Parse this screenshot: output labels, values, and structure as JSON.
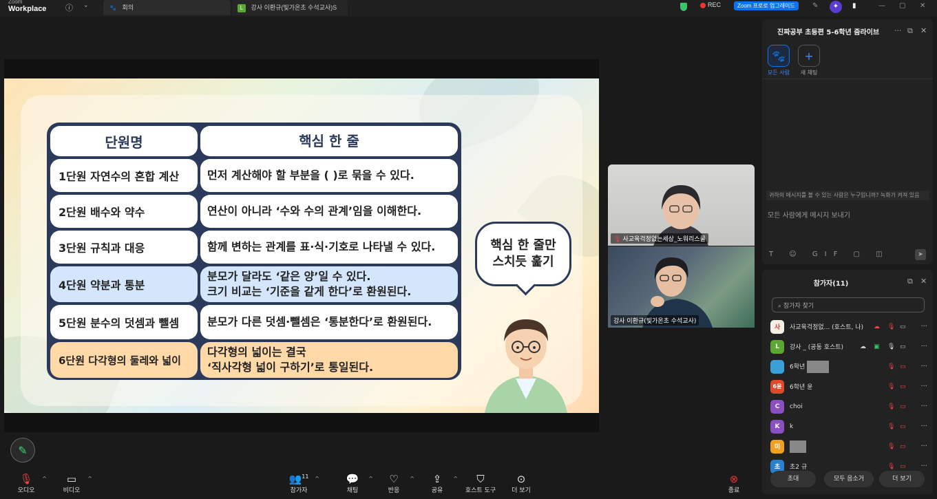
{
  "topbar": {
    "brand_line1": "Zoom",
    "brand_line2": "Workplace",
    "meeting_tab": "회의",
    "talk_tab": "강사 이환규(빛가온초 수석교사)S",
    "rec_label": "REC",
    "upgrade_label": "Zoom 프로로 업그레이드"
  },
  "slide": {
    "header": [
      "단원명",
      "핵심 한 줄"
    ],
    "rows": [
      {
        "unit": "1단원 자연수의 혼합 계산",
        "line1": "먼저 계산해야 할 부분을 (   )로 묶을 수 있다.",
        "line2": ""
      },
      {
        "unit": "2단원 배수와 약수",
        "line1": "연산이 아니라 ‘수와 수의 관계’임을 이해한다.",
        "line2": ""
      },
      {
        "unit": "3단원 규칙과 대응",
        "line1": "함께 변하는 관계를 표·식·기호로 나타낼 수 있다.",
        "line2": ""
      },
      {
        "unit": "4단원 약분과 통분",
        "line1": "분모가 달라도 ‘같은 양’일 수 있다.",
        "line2": "크기 비교는 ‘기준을 같게 한다’로 환원된다."
      },
      {
        "unit": "5단원 분수의 덧셈과 뺄셈",
        "line1": "분모가 다른 덧셈·뺄셈은 ‘통분한다’로 환원된다.",
        "line2": ""
      },
      {
        "unit": "6단원 다각형의 둘레와 넓이",
        "line1": "다각형의 넓이는 결국",
        "line2": "‘직사각형 넓이 구하기’로 통일된다."
      }
    ],
    "bubble_line1": "핵심 한 줄만",
    "bubble_line2": "스치듯 훑기"
  },
  "videos": [
    {
      "name": "사교육걱정없는세상_노워리스쿨"
    },
    {
      "name": "강사 이환규(빛가온초 수석교사)"
    }
  ],
  "chat": {
    "title": "진짜공부 초등편 5-6학년 줌라이브",
    "everyone_label": "모든 사람",
    "new_chat_label": "새 채팅",
    "notice": "귀하의 메시지를 볼 수 있는 사람은 누구입니까? 녹화가 켜져 있음",
    "input_placeholder": "모든 사람에게 메시지 보내기",
    "tools": "T ☺ GIF ▢ ◫"
  },
  "participants": {
    "title": "참가자(11)",
    "search_placeholder": "참가자 찾기",
    "items": [
      {
        "avatar": "사",
        "name": "사교육걱정없... (호스트, 나)",
        "color": "#f5f0e6"
      },
      {
        "avatar": "L",
        "name": "강사 _ (공동 호스트)",
        "color": "#5aa832"
      },
      {
        "avatar": "",
        "name": "6학년",
        "color": "#3aa0d8"
      },
      {
        "avatar": "6윤",
        "name": "6학년 윤",
        "color": "#e04a2a"
      },
      {
        "avatar": "C",
        "name": "choi",
        "color": "#8a4fc0"
      },
      {
        "avatar": "K",
        "name": "k",
        "color": "#8a4fc0"
      },
      {
        "avatar": "미",
        "name": "",
        "color": "#f0a020"
      },
      {
        "avatar": "초",
        "name": "초2 규",
        "color": "#2a7fd0"
      }
    ],
    "invite_label": "초대",
    "mute_all_label": "모두 음소거",
    "more_label": "더 보기"
  },
  "toolbar": {
    "audio": "오디오",
    "video": "비디오",
    "participants": "참가자",
    "participants_count": "11",
    "chat": "채팅",
    "reactions": "반응",
    "share": "공유",
    "host_tools": "호스트 도구",
    "more": "더 보기",
    "end": "종료"
  },
  "colors": {
    "accent": "#0e72ed",
    "table_border": "#2b3a5a",
    "row_blue": "#d4e6fb",
    "row_orange": "#ffd9a8"
  }
}
